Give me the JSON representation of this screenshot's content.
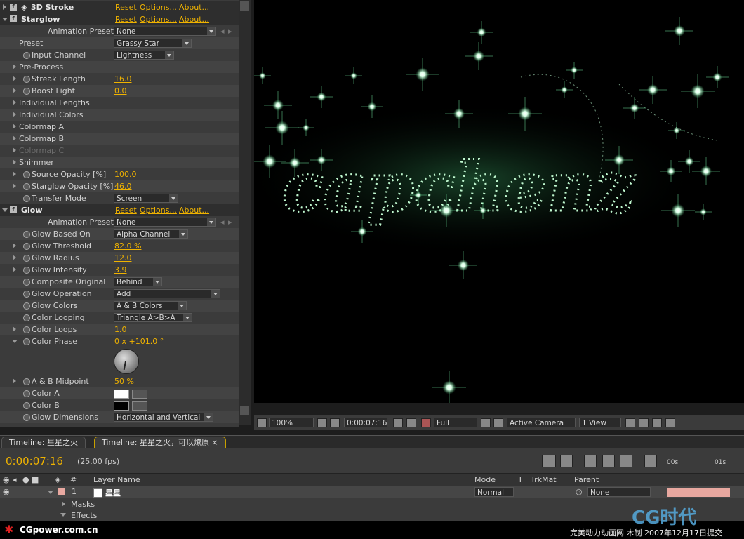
{
  "effects": {
    "stroke3d": {
      "name": "3D Stroke",
      "reset": "Reset",
      "options": "Options...",
      "about": "About..."
    },
    "starglow": {
      "name": "Starglow",
      "reset": "Reset",
      "options": "Options...",
      "about": "About...",
      "presets_label": "Animation Presets:",
      "presets_value": "None",
      "preset_label": "Preset",
      "preset_value": "Grassy Star",
      "input_channel_label": "Input Channel",
      "input_channel_value": "Lightness",
      "pre_process": "Pre-Process",
      "streak_length_label": "Streak Length",
      "streak_length_value": "16.0",
      "boost_light_label": "Boost Light",
      "boost_light_value": "0.0",
      "individual_lengths": "Individual Lengths",
      "individual_colors": "Individual Colors",
      "colormap_a": "Colormap A",
      "colormap_b": "Colormap B",
      "colormap_c": "Colormap C",
      "shimmer": "Shimmer",
      "source_opacity_label": "Source Opacity [%]",
      "source_opacity_value": "100.0",
      "starglow_opacity_label": "Starglow Opacity [%]",
      "starglow_opacity_value": "46.0",
      "transfer_mode_label": "Transfer Mode",
      "transfer_mode_value": "Screen"
    },
    "glow": {
      "name": "Glow",
      "reset": "Reset",
      "options": "Options...",
      "about": "About...",
      "presets_label": "Animation Presets:",
      "presets_value": "None",
      "based_on_label": "Glow Based On",
      "based_on_value": "Alpha Channel",
      "threshold_label": "Glow Threshold",
      "threshold_value": "82.0 %",
      "radius_label": "Glow Radius",
      "radius_value": "12.0",
      "intensity_label": "Glow Intensity",
      "intensity_value": "3.9",
      "composite_label": "Composite Original",
      "composite_value": "Behind",
      "operation_label": "Glow Operation",
      "operation_value": "Add",
      "colors_label": "Glow Colors",
      "colors_value": "A & B Colors",
      "looping_label": "Color Looping",
      "looping_value": "Triangle A>B>A",
      "loops_label": "Color Loops",
      "loops_value": "1.0",
      "phase_label": "Color Phase",
      "phase_value": "0 x +101.0 °",
      "midpoint_label": "A & B Midpoint",
      "midpoint_value": "50 %",
      "color_a_label": "Color A",
      "color_a": "#ffffff",
      "color_b_label": "Color B",
      "color_b": "#000000",
      "dimensions_label": "Glow Dimensions",
      "dimensions_value": "Horizontal and Vertical"
    }
  },
  "viewer": {
    "zoom": "100%",
    "timecode": "0:00:07:16",
    "resolution": "Full",
    "camera": "Active Camera",
    "view": "1 View"
  },
  "timeline": {
    "tab1": "Timeline: 星星之火",
    "tab2": "Timeline: 星星之火，可以燎原",
    "current_time": "0:00:07:16",
    "fps": "(25.00 fps)",
    "ruler_start": "00s",
    "ruler_end": "01s",
    "columns": {
      "num": "#",
      "layer_name": "Layer Name",
      "mode": "Mode",
      "t": "T",
      "trkmat": "TrkMat",
      "parent": "Parent"
    },
    "layer": {
      "number": "1",
      "name": "星星",
      "mode": "Normal",
      "parent": "None",
      "color": "#e8a8a0"
    },
    "masks": "Masks",
    "effects": "Effects"
  },
  "footer": {
    "brand": "CGpower.com.cn",
    "logo": "CG时代",
    "credit": "完美动力动画网 木制 2007年12月17日提交"
  },
  "colors": {
    "accent": "#f0b300",
    "glow": "#7dffb0"
  }
}
